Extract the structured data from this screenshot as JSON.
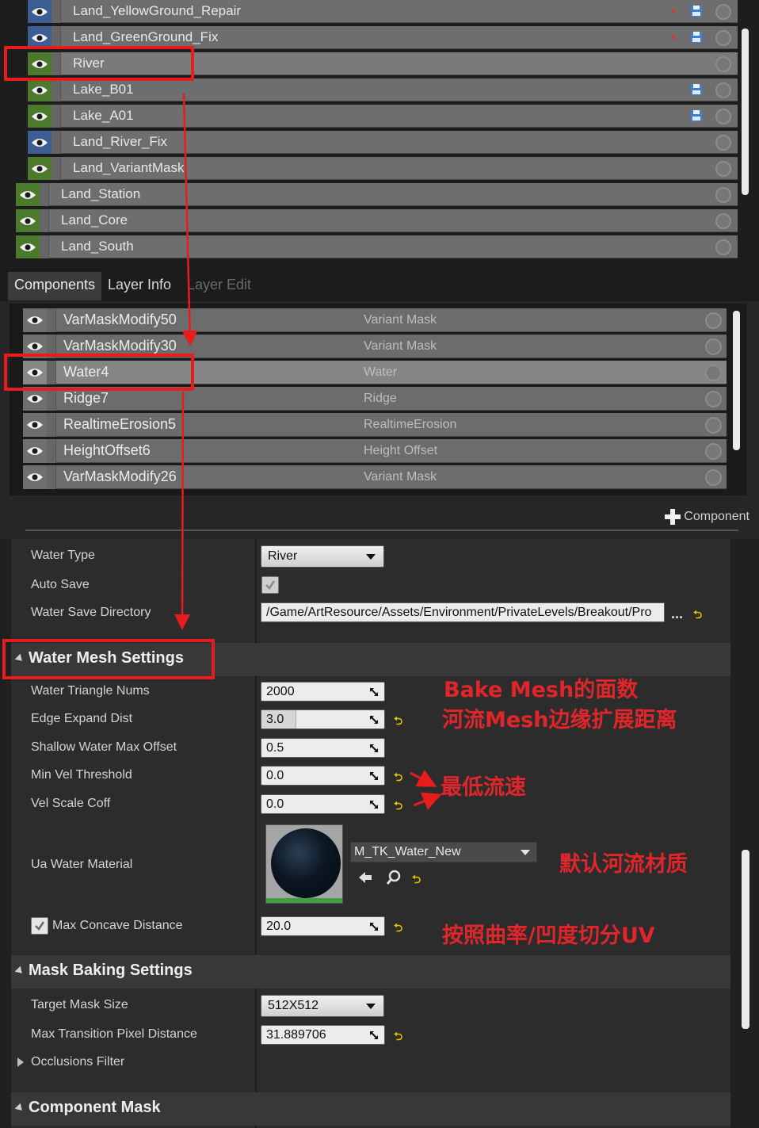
{
  "layers": {
    "rows": [
      {
        "name": "Land_YellowGround_Repair",
        "eye": "blue",
        "indent": 1,
        "unsaved": true,
        "save": true
      },
      {
        "name": "Land_GreenGround_Fix",
        "eye": "blue",
        "indent": 1,
        "unsaved": true,
        "save": true
      },
      {
        "name": "River",
        "eye": "green",
        "indent": 1,
        "unsaved": false,
        "save": false,
        "selected": true
      },
      {
        "name": "Lake_B01",
        "eye": "green",
        "indent": 1,
        "unsaved": false,
        "save": true
      },
      {
        "name": "Lake_A01",
        "eye": "green",
        "indent": 1,
        "unsaved": false,
        "save": true
      },
      {
        "name": "Land_River_Fix",
        "eye": "blue",
        "indent": 1,
        "unsaved": false,
        "save": false
      },
      {
        "name": "Land_VariantMask",
        "eye": "green",
        "indent": 1,
        "unsaved": false,
        "save": false
      },
      {
        "name": "Land_Station",
        "eye": "green",
        "indent": 0,
        "unsaved": false,
        "save": false
      },
      {
        "name": "Land_Core",
        "eye": "green",
        "indent": 0,
        "unsaved": false,
        "save": false
      },
      {
        "name": "Land_South",
        "eye": "green",
        "indent": 0,
        "unsaved": false,
        "save": false
      }
    ]
  },
  "tabs": {
    "components": "Components",
    "layer_info": "Layer Info",
    "layer_edit": "Layer Edit"
  },
  "components": {
    "rows": [
      {
        "name": "VarMaskModify50",
        "type": "Variant Mask"
      },
      {
        "name": "VarMaskModify30",
        "type": "Variant Mask"
      },
      {
        "name": "Water4",
        "type": "Water",
        "selected": true
      },
      {
        "name": "Ridge7",
        "type": "Ridge"
      },
      {
        "name": "RealtimeErosion5",
        "type": "RealtimeErosion"
      },
      {
        "name": "HeightOffset6",
        "type": "Height Offset"
      },
      {
        "name": "VarMaskModify26",
        "type": "Variant Mask"
      }
    ],
    "add_label": "Component"
  },
  "details": {
    "water_type_label": "Water Type",
    "water_type_value": "River",
    "auto_save_label": "Auto Save",
    "save_dir_label": "Water Save Directory",
    "save_dir_value": "/Game/ArtResource/Assets/Environment/PrivateLevels/Breakout/Pro",
    "save_dir_more": "...",
    "water_mesh_section": "Water Mesh Settings",
    "triangle_label": "Water Triangle Nums",
    "triangle_value": "2000",
    "edge_label": "Edge Expand Dist",
    "edge_value": "3.0",
    "shallow_label": "Shallow Water Max Offset",
    "shallow_value": "0.5",
    "minvel_label": "Min Vel Threshold",
    "minvel_value": "0.0",
    "velscale_label": "Vel Scale Coff",
    "velscale_value": "0.0",
    "material_label": "Ua Water Material",
    "material_value": "M_TK_Water_New",
    "concave_label": "Max Concave Distance",
    "concave_value": "20.0",
    "mask_section": "Mask Baking Settings",
    "target_mask_label": "Target Mask Size",
    "target_mask_value": "512X512",
    "transition_label": "Max Transition Pixel Distance",
    "transition_value": "31.889706",
    "occlusion_label": "Occlusions Filter",
    "component_mask_section": "Component Mask"
  },
  "annotations": {
    "bake_mesh": "Bake Mesh的面数",
    "edge_expand": "河流Mesh边缘扩展距离",
    "min_speed": "最低流速",
    "default_material": "默认河流材质",
    "uv_split": "按照曲率/凹度切分UV"
  },
  "colors": {
    "eye_blue": "#3d5e92",
    "eye_green": "#4c7a2c",
    "annotation_red": "#e0262a",
    "reset_yellow": "#e6c200"
  }
}
